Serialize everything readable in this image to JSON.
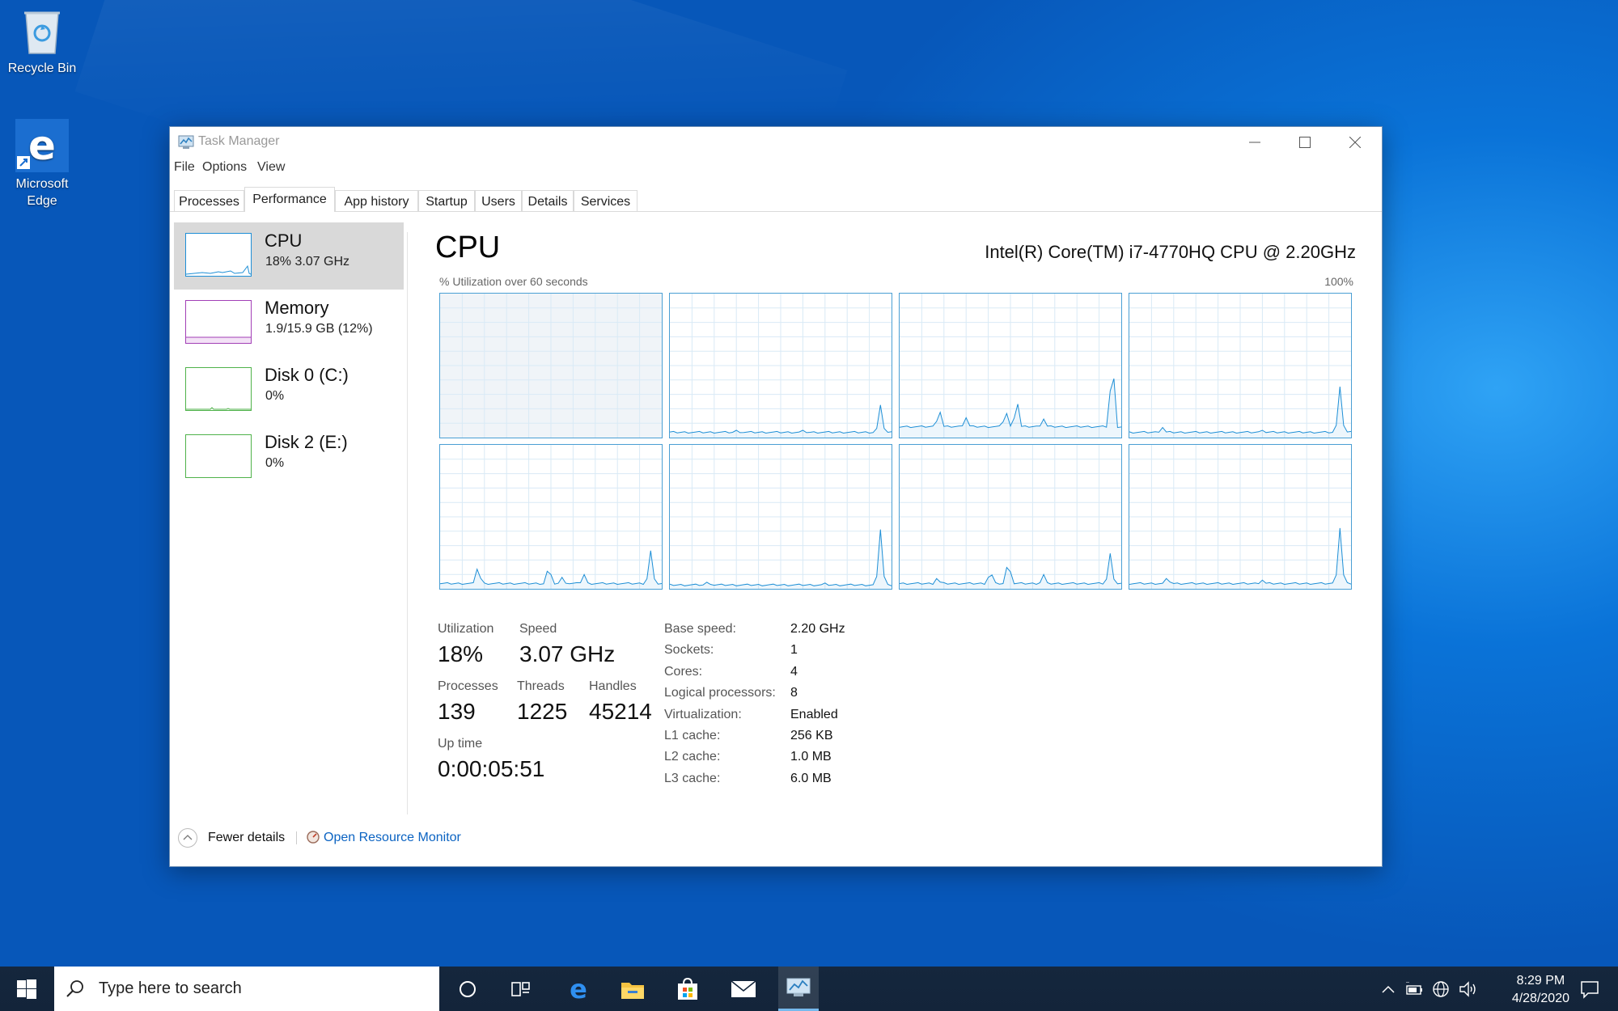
{
  "desktop": {
    "icons": [
      {
        "label": "Recycle Bin"
      },
      {
        "label": "Microsoft Edge"
      }
    ]
  },
  "window": {
    "title": "Task Manager",
    "menu": [
      "File",
      "Options",
      "View"
    ],
    "tabs": [
      "Processes",
      "Performance",
      "App history",
      "Startup",
      "Users",
      "Details",
      "Services"
    ],
    "active_tab": "Performance"
  },
  "sidebar": {
    "items": [
      {
        "name": "CPU",
        "sub": "18%  3.07 GHz",
        "color": "#1e8fd6"
      },
      {
        "name": "Memory",
        "sub": "1.9/15.9 GB (12%)",
        "color": "#a23fb6"
      },
      {
        "name": "Disk 0 (C:)",
        "sub": "0%",
        "color": "#4fb24a"
      },
      {
        "name": "Disk 2 (E:)",
        "sub": "0%",
        "color": "#4fb24a"
      }
    ]
  },
  "main": {
    "title": "CPU",
    "cpu_model": "Intel(R) Core(TM) i7-4770HQ CPU @ 2.20GHz",
    "graph_label": "% Utilization over 60 seconds",
    "graph_max": "100%",
    "graph_color": "#1e8fd6"
  },
  "stats": {
    "utilization": {
      "label": "Utilization",
      "value": "18%"
    },
    "speed": {
      "label": "Speed",
      "value": "3.07 GHz"
    },
    "processes": {
      "label": "Processes",
      "value": "139"
    },
    "threads": {
      "label": "Threads",
      "value": "1225"
    },
    "handles": {
      "label": "Handles",
      "value": "45214"
    },
    "uptime": {
      "label": "Up time",
      "value": "0:00:05:51"
    }
  },
  "properties": [
    {
      "label": "Base speed:",
      "value": "2.20 GHz"
    },
    {
      "label": "Sockets:",
      "value": "1"
    },
    {
      "label": "Cores:",
      "value": "4"
    },
    {
      "label": "Logical processors:",
      "value": "8"
    },
    {
      "label": "Virtualization:",
      "value": "Enabled"
    },
    {
      "label": "L1 cache:",
      "value": "256 KB"
    },
    {
      "label": "L2 cache:",
      "value": "1.0 MB"
    },
    {
      "label": "L3 cache:",
      "value": "6.0 MB"
    }
  ],
  "footer": {
    "fewer_details": "Fewer details",
    "resource_monitor": "Open Resource Monitor"
  },
  "taskbar": {
    "search_placeholder": "Type here to search",
    "time": "8:29 PM",
    "date": "4/28/2020"
  }
}
